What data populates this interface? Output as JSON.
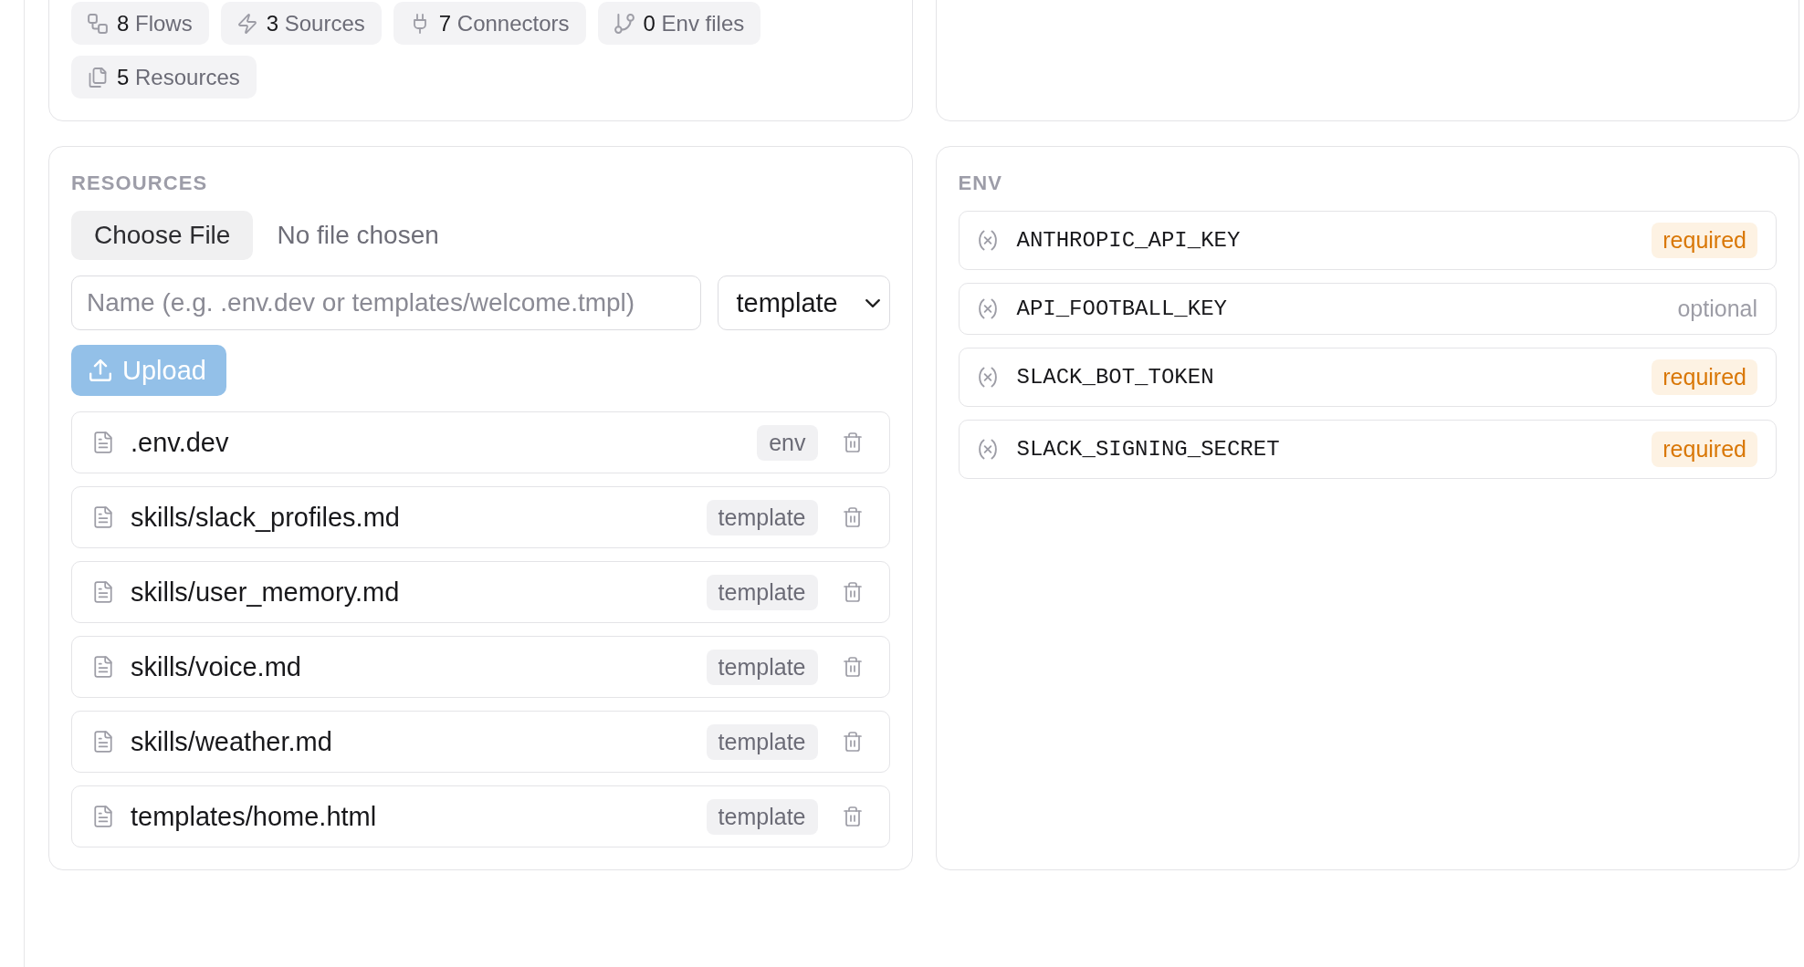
{
  "stats": {
    "chips": [
      {
        "count": "8",
        "label": "Flows"
      },
      {
        "count": "3",
        "label": "Sources"
      },
      {
        "count": "7",
        "label": "Connectors"
      },
      {
        "count": "0",
        "label": "Env files"
      },
      {
        "count": "5",
        "label": "Resources"
      }
    ]
  },
  "resources": {
    "heading": "RESOURCES",
    "file_picker": {
      "button": "Choose File",
      "status": "No file chosen"
    },
    "name_field": {
      "placeholder": "Name (e.g. .env.dev or templates/welcome.tmpl)"
    },
    "type_select": {
      "value": "template"
    },
    "upload_button": {
      "label": "Upload",
      "disabled": true
    },
    "files": [
      {
        "name": ".env.dev",
        "type": "env"
      },
      {
        "name": "skills/slack_profiles.md",
        "type": "template"
      },
      {
        "name": "skills/user_memory.md",
        "type": "template"
      },
      {
        "name": "skills/voice.md",
        "type": "template"
      },
      {
        "name": "skills/weather.md",
        "type": "template"
      },
      {
        "name": "templates/home.html",
        "type": "template"
      }
    ]
  },
  "env": {
    "heading": "ENV",
    "variables": [
      {
        "name": "ANTHROPIC_API_KEY",
        "badge": "required",
        "required": true
      },
      {
        "name": "API_FOOTBALL_KEY",
        "badge": "optional",
        "required": false
      },
      {
        "name": "SLACK_BOT_TOKEN",
        "badge": "required",
        "required": true
      },
      {
        "name": "SLACK_SIGNING_SECRET",
        "badge": "required",
        "required": true
      }
    ]
  }
}
